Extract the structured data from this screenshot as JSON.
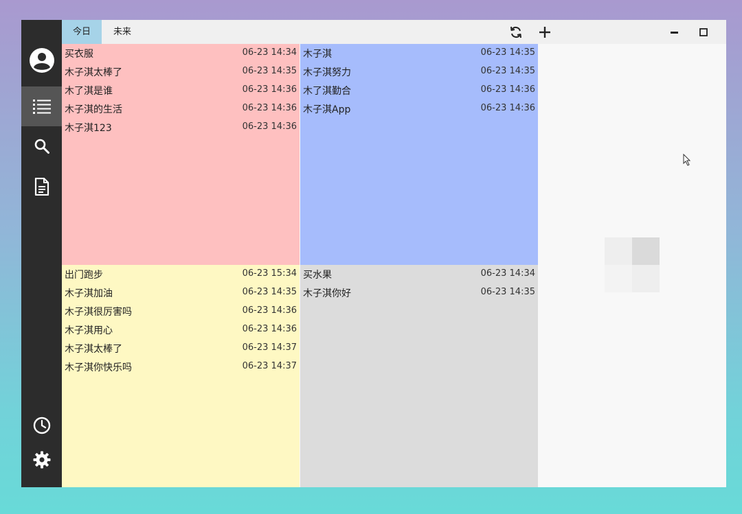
{
  "tabs": [
    "今日",
    "未来"
  ],
  "sidebar": {
    "top_icons": [
      "account-icon",
      "list-icon",
      "search-icon",
      "document-icon"
    ],
    "bottom_icons": [
      "clock-icon",
      "settings-icon"
    ]
  },
  "toolbar": {
    "sync_icon": "sync-icon",
    "add_icon": "plus-icon",
    "minimize_icon": "minimize-icon",
    "maximize_icon": "maximize-icon",
    "close_icon": "close-icon"
  },
  "quadrants": [
    {
      "color": "#fec0c0",
      "items": [
        {
          "title": "买衣服",
          "time": "06-23 14:34"
        },
        {
          "title": "木子淇太棒了",
          "time": "06-23 14:35"
        },
        {
          "title": "木了淇是谁",
          "time": "06-23 14:36"
        },
        {
          "title": "木子淇的生活",
          "time": "06-23 14:36"
        },
        {
          "title": "木子淇123",
          "time": "06-23 14:36"
        }
      ]
    },
    {
      "color": "#a6bcfc",
      "items": [
        {
          "title": "木子淇",
          "time": "06-23 14:35"
        },
        {
          "title": "木子淇努力",
          "time": "06-23 14:35"
        },
        {
          "title": "木了淇勤合",
          "time": "06-23 14:36"
        },
        {
          "title": "木子淇App",
          "time": "06-23 14:36"
        }
      ]
    },
    {
      "color": "#fef8c3",
      "items": [
        {
          "title": "出门跑步",
          "time": "06-23 15:34"
        },
        {
          "title": "木子淇加油",
          "time": "06-23 14:35"
        },
        {
          "title": "木子淇很厉害吗",
          "time": "06-23 14:36"
        },
        {
          "title": "木子淇用心",
          "time": "06-23 14:36"
        },
        {
          "title": "木子淇太棒了",
          "time": "06-23 14:37"
        },
        {
          "title": "木子淇你快乐吗",
          "time": "06-23 14:37"
        }
      ]
    },
    {
      "color": "#dcdcdc",
      "items": [
        {
          "title": "买水果",
          "time": "06-23 14:34"
        },
        {
          "title": "木子淇你好",
          "time": "06-23 14:35"
        }
      ]
    }
  ]
}
